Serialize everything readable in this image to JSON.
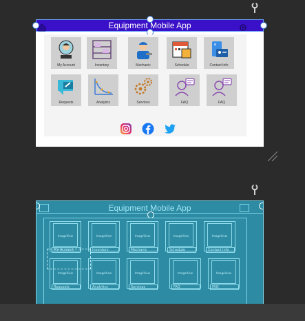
{
  "design": {
    "app_title": "Equipment Mobile App",
    "tiles": [
      {
        "label": "My Account",
        "icon": "user-icon"
      },
      {
        "label": "Inventory",
        "icon": "shelves-icon"
      },
      {
        "label": "Mechanic",
        "icon": "mechanic-icon"
      },
      {
        "label": "Schedule",
        "icon": "calendar-icon"
      },
      {
        "label": "Contact Info",
        "icon": "contact-icon"
      },
      {
        "label": "Requests",
        "icon": "request-icon"
      },
      {
        "label": "Analytics",
        "icon": "chart-icon"
      },
      {
        "label": "Services",
        "icon": "gears-icon"
      },
      {
        "label": "FAQ",
        "icon": "faq-icon"
      },
      {
        "label": "FAQ",
        "icon": "faq-icon"
      }
    ],
    "social": [
      "instagram-icon",
      "facebook-icon",
      "twitter-icon"
    ]
  },
  "blueprint": {
    "app_title": "Equipment Mobile App",
    "placeholder": "ImageView",
    "tile_labels": [
      "My Account",
      "Inventory",
      "Mechanic",
      "Schedule",
      "Contact Info",
      "Requests",
      "Analytics",
      "Services",
      "FAQ",
      "FAQ"
    ]
  },
  "colors": {
    "title_bar": "#3a10c8",
    "blueprint_bg": "#2d8ba3",
    "canvas_bg": "#2b2b2b",
    "selection": "#3a7bd5"
  }
}
